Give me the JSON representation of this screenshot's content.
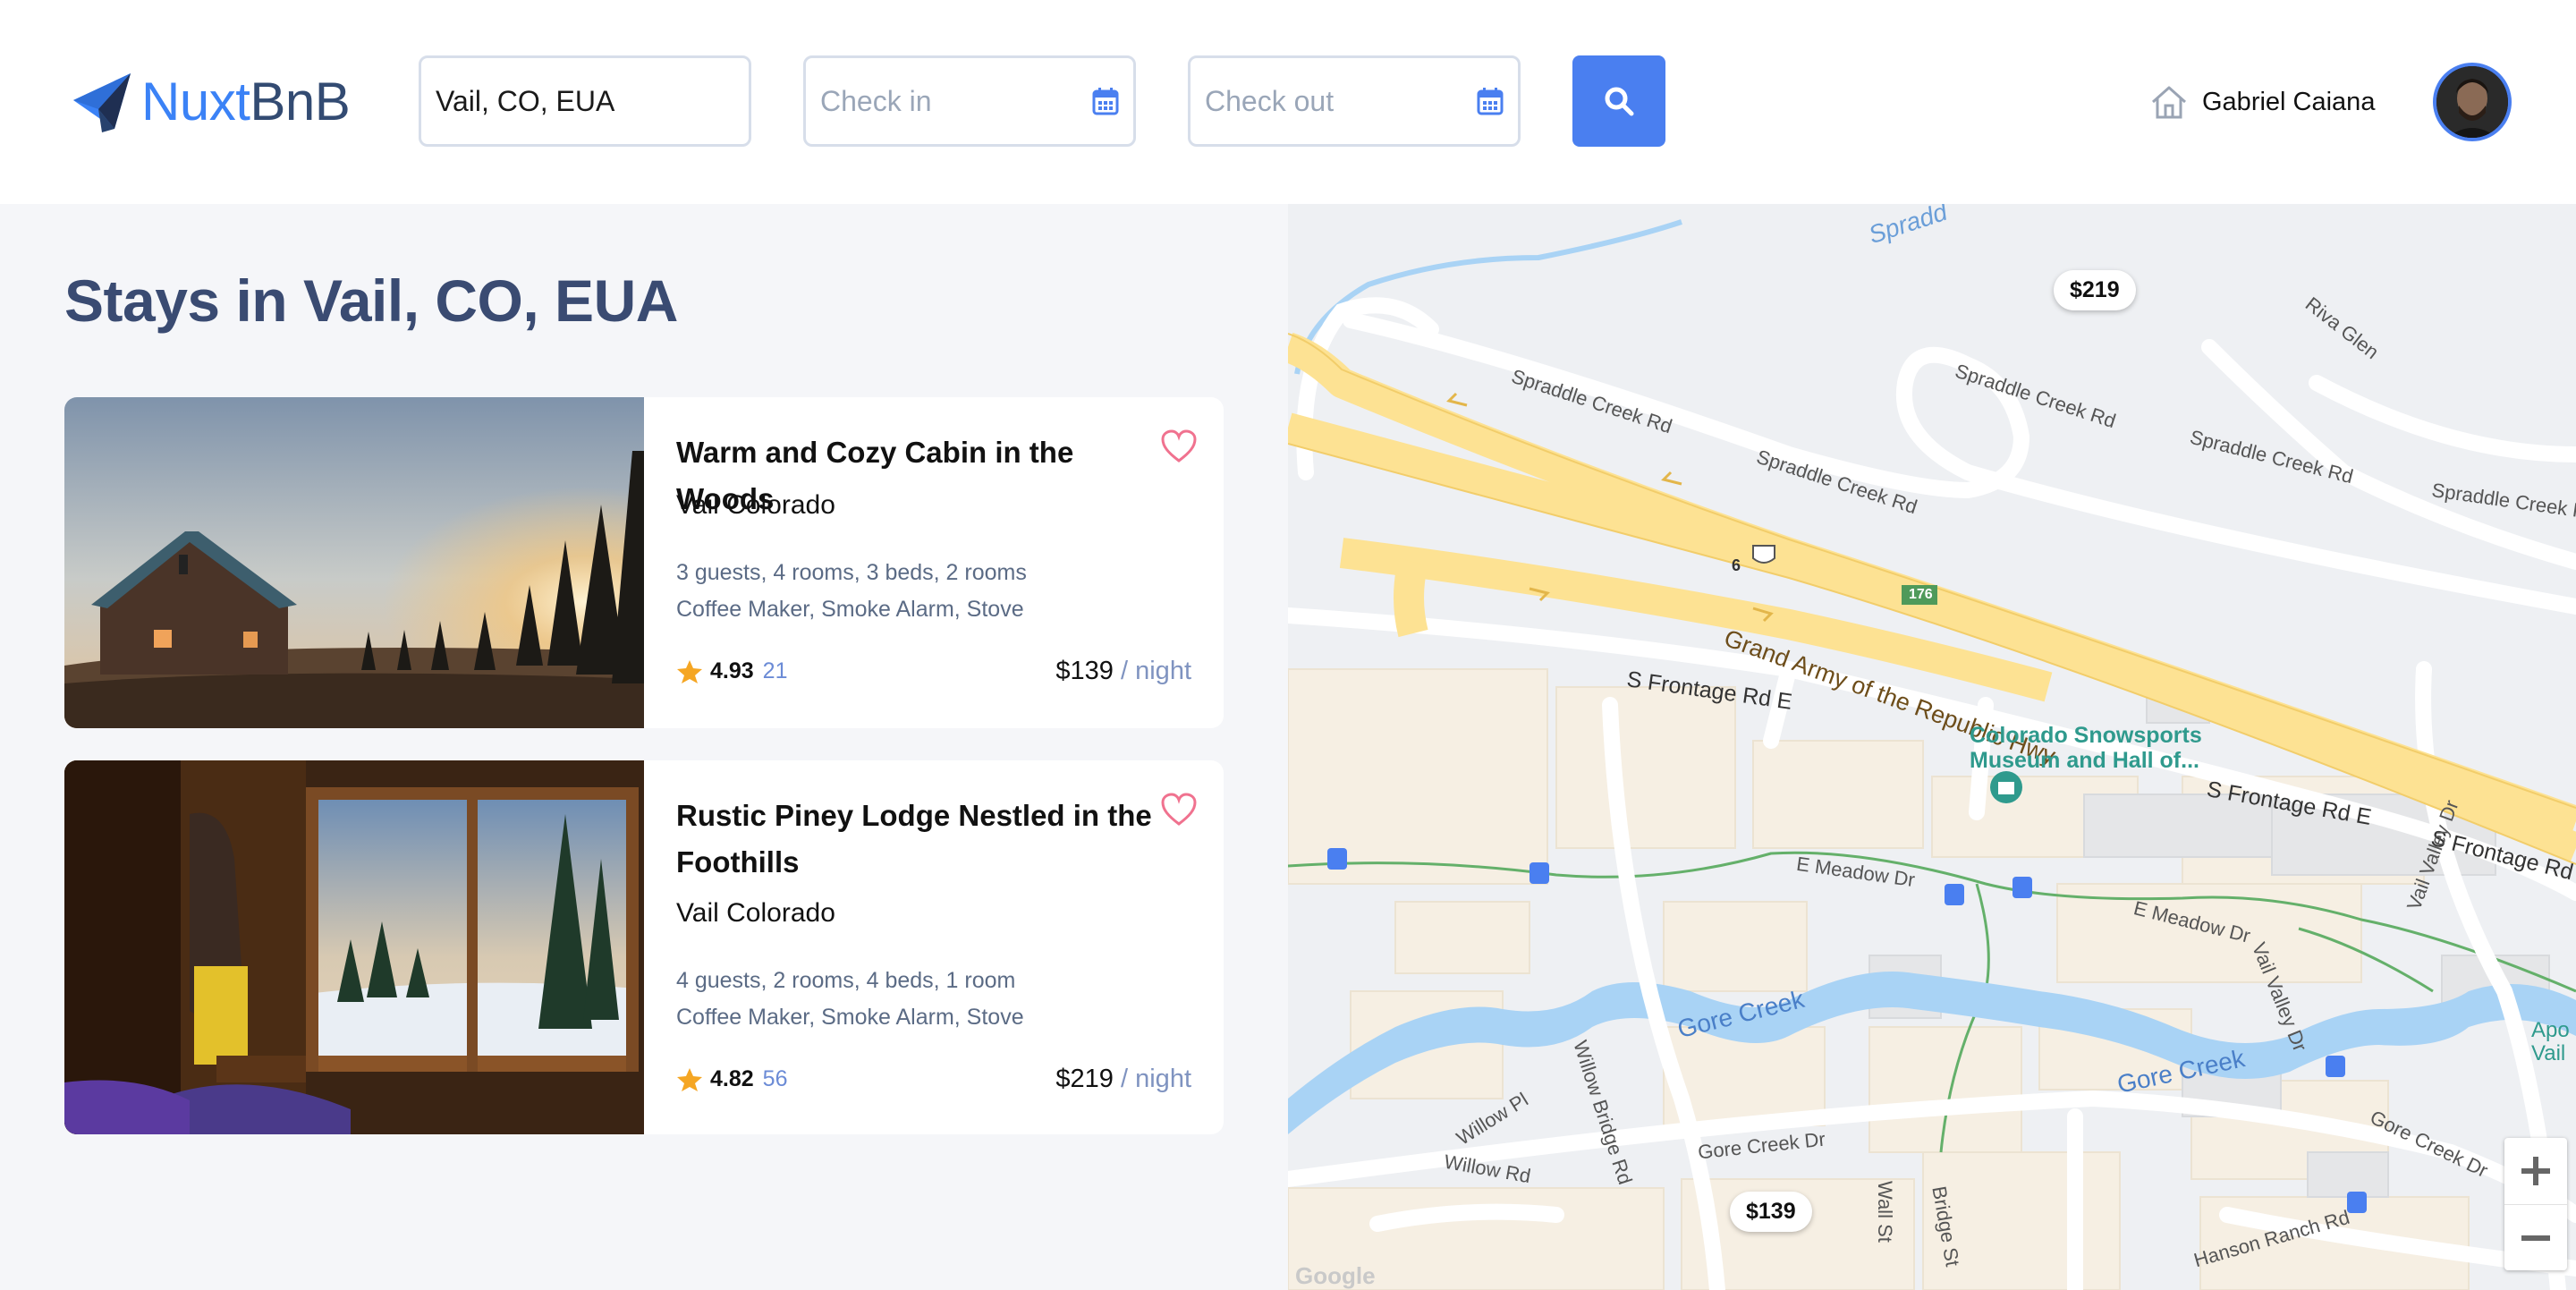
{
  "header": {
    "logo_part1": "Nuxt",
    "logo_part2": "BnB",
    "location_value": "Vail, CO, EUA",
    "checkin_placeholder": "Check in",
    "checkout_placeholder": "Check out",
    "user_name": "Gabriel Caiana"
  },
  "listing": {
    "title": "Stays in Vail, CO, EUA",
    "homes": [
      {
        "title": "Warm and Cozy Cabin in the Woods",
        "location": "Vail Colorado",
        "details": "3 guests, 4 rooms, 3 beds, 2 rooms",
        "amenities": "Coffee Maker, Smoke Alarm, Stove",
        "rating": "4.93",
        "reviews": "21",
        "price": "$139",
        "per": "/ night"
      },
      {
        "title": "Rustic Piney Lodge Nestled in the Foothills",
        "location": "Vail Colorado",
        "details": "4 guests, 2 rooms, 4 beds, 1 room",
        "amenities": "Coffee Maker, Smoke Alarm, Stove",
        "rating": "4.82",
        "reviews": "56",
        "price": "$219",
        "per": "/ night"
      }
    ]
  },
  "map": {
    "pins": [
      "$219",
      "$139"
    ],
    "labels": {
      "spraddle_top": "Spradd",
      "spraddle_1": "Spraddle Creek Rd",
      "spraddle_2": "Spraddle Creek Rd",
      "spraddle_3": "Spraddle Creek Rd",
      "spraddle_4": "Spraddle Creek Rd",
      "spraddle_5": "Spraddle Creek Rd",
      "riva_glen": "Riva Glen",
      "highway": "Grand Army of the Republic Hwy",
      "frontage_1": "S Frontage Rd E",
      "frontage_2": "S Frontage Rd E",
      "frontage_3": "S Frontage Rd",
      "meadow_1": "E Meadow Dr",
      "meadow_2": "E Meadow Dr",
      "gore_creek_1": "Gore Creek",
      "gore_creek_2": "Gore Creek",
      "gore_creek_dr_1": "Gore Creek Dr",
      "gore_creek_dr_2": "Gore Creek Dr",
      "willow_bridge": "Willow Bridge Rd",
      "willow_pl": "Willow Pl",
      "willow_rd": "Willow Rd",
      "wall_st": "Wall St",
      "bridge_st": "Bridge St",
      "vail_valley_1": "Vail Valley Dr",
      "vail_valley_2": "Vail Valley Dr",
      "hanson": "Hanson Ranch Rd",
      "poi_line1": "Colorado Snowsports",
      "poi_line2": "Museum and Hall of...",
      "shield_6": "6",
      "shield_176": "176",
      "apo": "Apo",
      "vail": "Vail",
      "google": "Google"
    }
  },
  "colors": {
    "brand_blue": "#3b82f6",
    "title_navy": "#3a4b72",
    "heart_pink": "#f0728f",
    "star_amber": "#f5a623",
    "highway_yellow": "#fde293"
  }
}
